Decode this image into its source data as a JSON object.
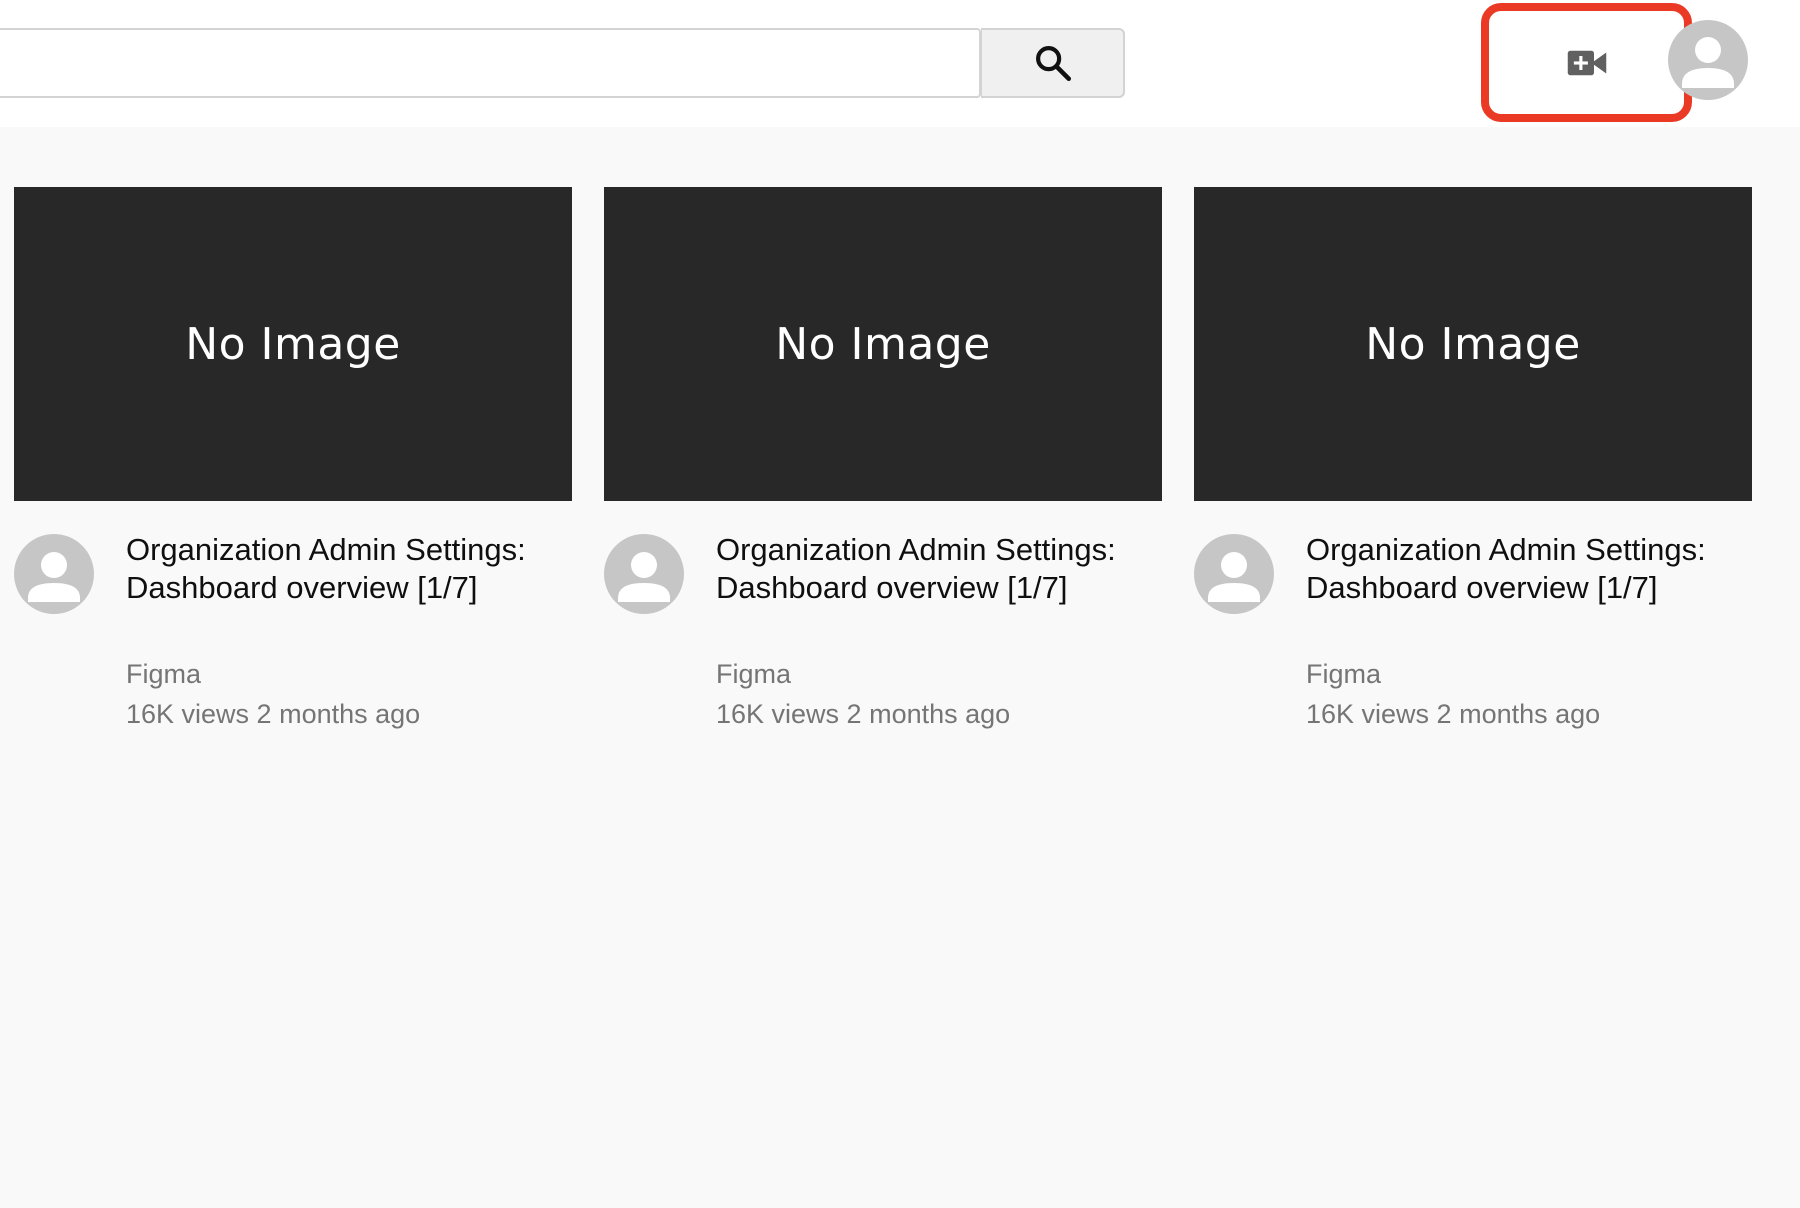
{
  "header": {
    "search": {
      "value": "",
      "placeholder": ""
    },
    "search_button_icon": "search-icon",
    "create_button_icon": "video-camera-plus-icon",
    "create_highlight_color": "#ea3a25",
    "account_icon": "person-icon"
  },
  "videos": [
    {
      "thumbnail_text": "No Image",
      "title": "Organization Admin Settings: Dashboard overview [1/7]",
      "channel": "Figma",
      "meta": "16K views 2 months ago"
    },
    {
      "thumbnail_text": "No Image",
      "title": "Organization Admin Settings: Dashboard overview [1/7]",
      "channel": "Figma",
      "meta": "16K views 2 months ago"
    },
    {
      "thumbnail_text": "No Image",
      "title": "Organization Admin Settings: Dashboard overview [1/7]",
      "channel": "Figma",
      "meta": "16K views 2 months ago"
    }
  ]
}
